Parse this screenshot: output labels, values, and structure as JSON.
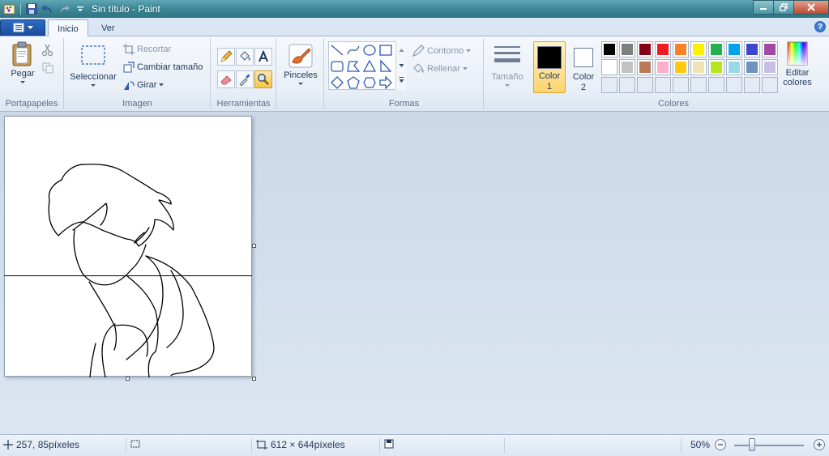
{
  "window": {
    "title": "Sin título - Paint"
  },
  "tabs": [
    {
      "label": "Inicio",
      "active": true
    },
    {
      "label": "Ver",
      "active": false
    }
  ],
  "help_label": "?",
  "groups": {
    "portapapeles": {
      "label": "Portapapeles",
      "paste_label": "Pegar"
    },
    "imagen": {
      "label": "Imagen",
      "select_label": "Seleccionar",
      "crop_label": "Recortar",
      "resize_label": "Cambiar tamaño",
      "rotate_label": "Girar"
    },
    "herramientas": {
      "label": "Herramientas"
    },
    "pinceles": {
      "label": "Pinceles"
    },
    "formas": {
      "label": "Formas",
      "outline_label": "Contorno",
      "fill_label": "Rellenar"
    },
    "tamano": {
      "label": "Tamaño"
    },
    "colores": {
      "label": "Colores",
      "color1_label": "Color 1",
      "color1_line1": "Color",
      "color1_line2": "1",
      "color2_line1": "Color",
      "color2_line2": "2",
      "edit_line1": "Editar",
      "edit_line2": "colores",
      "color1_value": "#000000",
      "color2_value": "#ffffff",
      "palette_row1": [
        "#000000",
        "#7f7f7f",
        "#880015",
        "#ed1c24",
        "#ff7f27",
        "#fff200",
        "#22b14c",
        "#00a2e8",
        "#3f48cc",
        "#a349a4"
      ],
      "palette_row2": [
        "#ffffff",
        "#c3c3c3",
        "#b97a57",
        "#ffaec9",
        "#ffc90e",
        "#efe4b0",
        "#b5e61d",
        "#99d9ea",
        "#7092be",
        "#c8bfe7"
      ]
    }
  },
  "status": {
    "cursor_pos": "257, 85píxeles",
    "image_size": "612 × 644píxeles",
    "zoom": "50%"
  }
}
